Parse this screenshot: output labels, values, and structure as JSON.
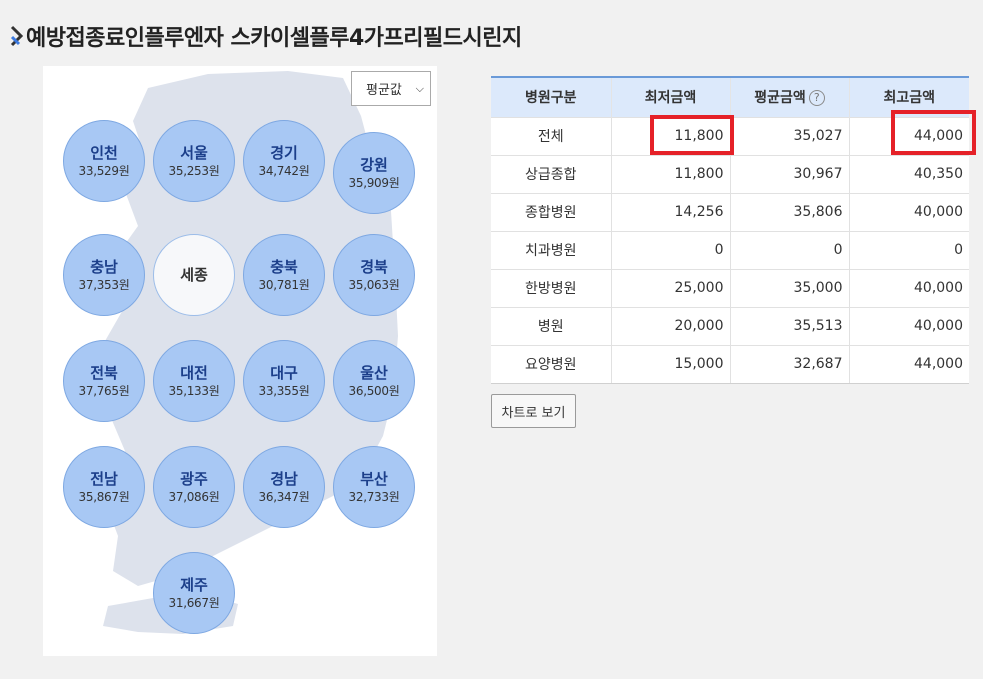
{
  "page": {
    "title": "예방접종료인플루엔자 스카이셀플루4가프리필드시린지"
  },
  "map": {
    "select_value": "평균값",
    "regions": [
      {
        "name": "인천",
        "price": "33,529원"
      },
      {
        "name": "서울",
        "price": "35,253원"
      },
      {
        "name": "경기",
        "price": "34,742원"
      },
      {
        "name": "강원",
        "price": "35,909원"
      },
      {
        "name": "충남",
        "price": "37,353원"
      },
      {
        "name": "세종",
        "price": ""
      },
      {
        "name": "충북",
        "price": "30,781원"
      },
      {
        "name": "경북",
        "price": "35,063원"
      },
      {
        "name": "전북",
        "price": "37,765원"
      },
      {
        "name": "대전",
        "price": "35,133원"
      },
      {
        "name": "대구",
        "price": "33,355원"
      },
      {
        "name": "울산",
        "price": "36,500원"
      },
      {
        "name": "전남",
        "price": "35,867원"
      },
      {
        "name": "광주",
        "price": "37,086원"
      },
      {
        "name": "경남",
        "price": "36,347원"
      },
      {
        "name": "부산",
        "price": "32,733원"
      },
      {
        "name": "제주",
        "price": "31,667원"
      }
    ]
  },
  "table": {
    "headers": [
      "병원구분",
      "최저금액",
      "평균금액",
      "최고금액"
    ],
    "help_icon": "?",
    "rows": [
      [
        "전체",
        "11,800",
        "35,027",
        "44,000"
      ],
      [
        "상급종합",
        "11,800",
        "30,967",
        "40,350"
      ],
      [
        "종합병원",
        "14,256",
        "35,806",
        "40,000"
      ],
      [
        "치과병원",
        "0",
        "0",
        "0"
      ],
      [
        "한방병원",
        "25,000",
        "35,000",
        "40,000"
      ],
      [
        "병원",
        "20,000",
        "35,513",
        "40,000"
      ],
      [
        "요양병원",
        "15,000",
        "32,687",
        "44,000"
      ]
    ]
  },
  "buttons": {
    "chart_view": "차트로 보기"
  },
  "colors": {
    "highlight": "#e52128",
    "region_fill": "#a8c8f4",
    "header_bg": "#dce9fb",
    "accent": "#6a9ad8"
  }
}
